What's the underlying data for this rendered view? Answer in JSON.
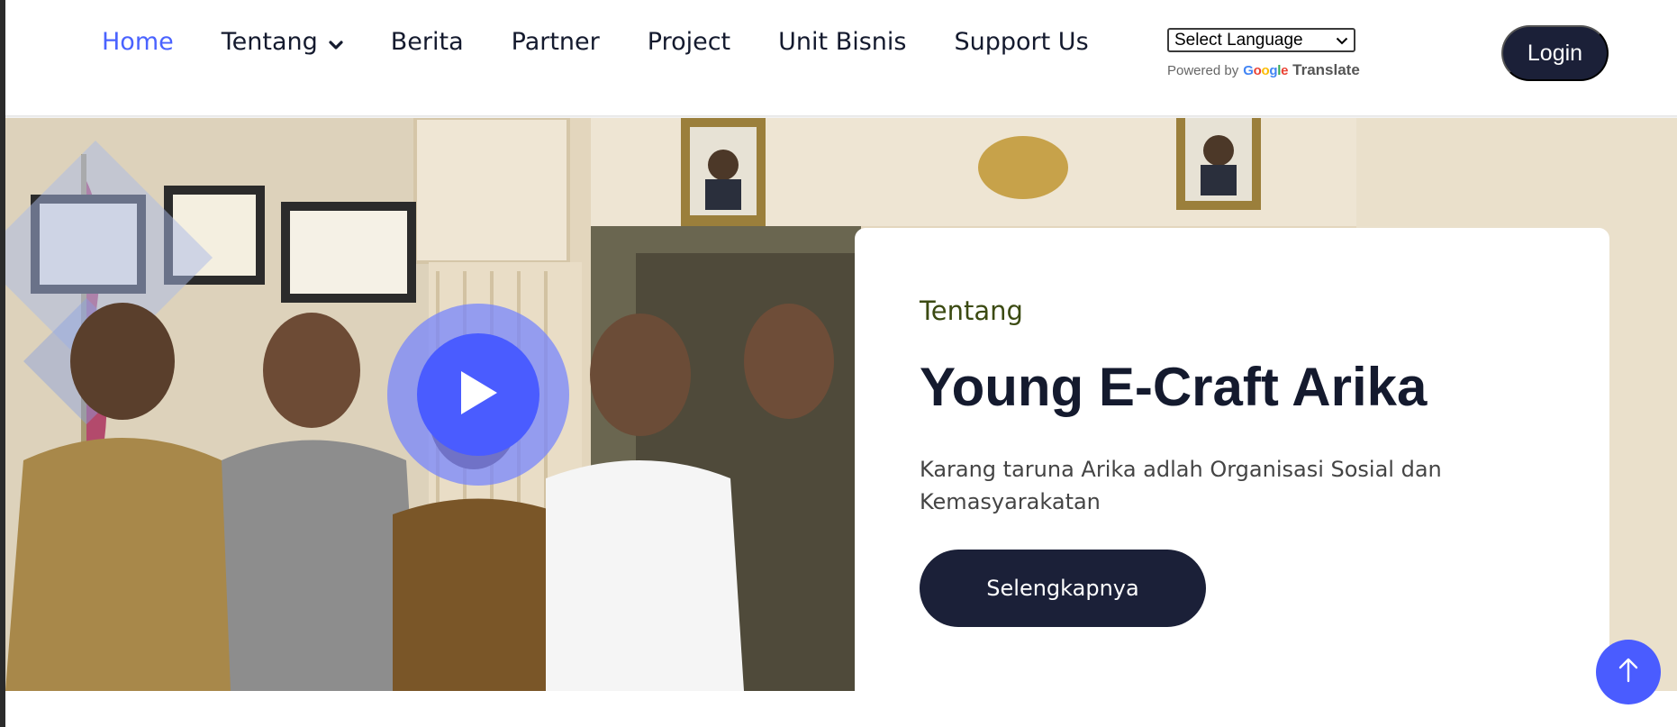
{
  "nav": {
    "items": [
      {
        "label": "Home",
        "active": true
      },
      {
        "label": "Tentang",
        "active": false,
        "has_dropdown": true
      },
      {
        "label": "Berita",
        "active": false
      },
      {
        "label": "Partner",
        "active": false
      },
      {
        "label": "Project",
        "active": false
      },
      {
        "label": "Unit Bisnis",
        "active": false
      },
      {
        "label": "Support Us",
        "active": false
      }
    ]
  },
  "translate": {
    "select_label": "Select Language",
    "powered_by": "Powered by",
    "brand": "Google",
    "product": "Translate"
  },
  "header": {
    "login_label": "Login"
  },
  "hero": {
    "eyebrow": "Tentang",
    "title": "Young E-Craft Arika",
    "description": "Karang taruna Arika adlah Organisasi Sosial dan Kemasyarakatan",
    "cta_label": "Selengkapnya"
  },
  "colors": {
    "accent": "#4a63ff",
    "dark": "#1b2038",
    "eyebrow": "#3b4a12",
    "play": "#4a5cff"
  },
  "icons": {
    "dropdown": "chevron-down-icon",
    "play": "play-icon",
    "scroll_top": "arrow-up-icon"
  }
}
